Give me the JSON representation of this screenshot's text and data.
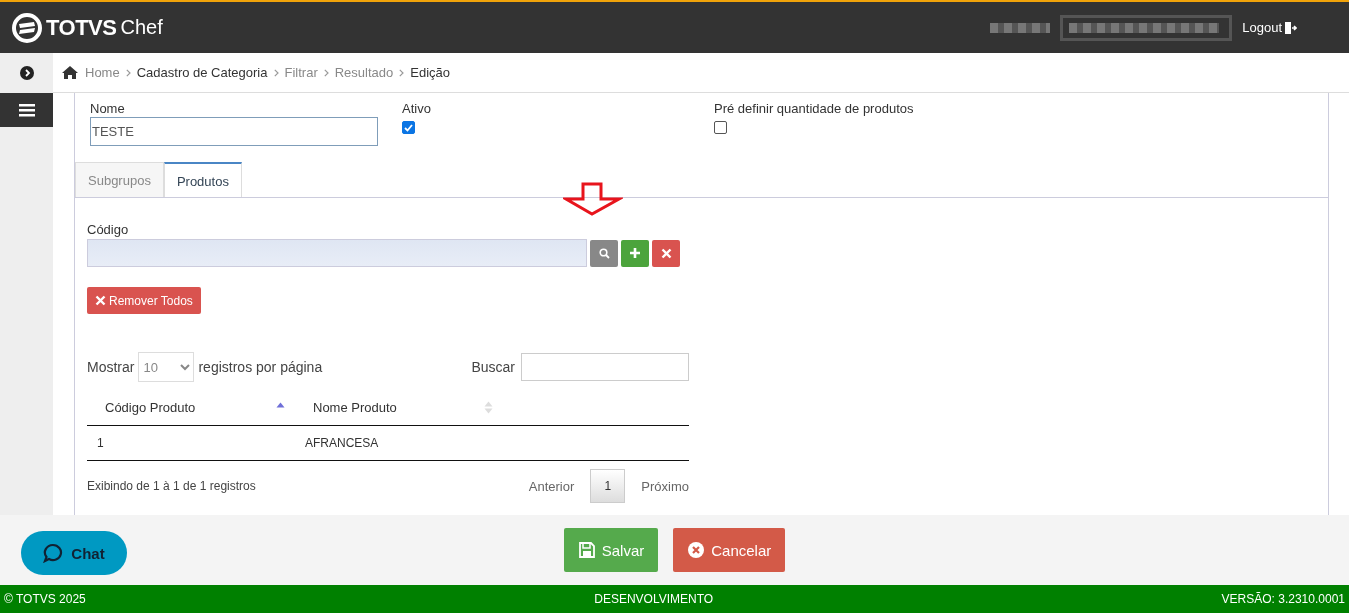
{
  "header": {
    "logo": {
      "brand": "TOTVS",
      "product": "Chef"
    },
    "logout": "Logout"
  },
  "breadcrumb": [
    {
      "label": "Home",
      "kind": "muted"
    },
    {
      "label": "Cadastro de Categoria",
      "kind": "strong"
    },
    {
      "label": "Filtrar",
      "kind": "muted"
    },
    {
      "label": "Resultado",
      "kind": "muted"
    },
    {
      "label": "Edição",
      "kind": "strong"
    }
  ],
  "form": {
    "name": {
      "label": "Nome",
      "value": "TESTE"
    },
    "active": {
      "label": "Ativo",
      "checked": true
    },
    "preset_quantity": {
      "label": "Pré definir quantidade de produtos",
      "checked": false
    }
  },
  "tabs": [
    {
      "label": "Subgrupos",
      "selected": false
    },
    {
      "label": "Produtos",
      "selected": true
    }
  ],
  "code_field": {
    "label": "Código"
  },
  "remove_all": "Remover Todos",
  "table": {
    "show_label": "Mostrar",
    "page_size": "10",
    "per_page_label": "registros por página",
    "search_label": "Buscar",
    "columns": [
      {
        "label": "Código Produto",
        "sorted": true
      },
      {
        "label": "Nome Produto",
        "sorted": false
      }
    ],
    "rows": [
      [
        "1",
        "AFRANCESA"
      ]
    ],
    "info": "Exibindo de 1 à 1 de 1 registros",
    "pagination": {
      "previous": "Anterior",
      "pages": [
        {
          "label": "1",
          "selected": true
        }
      ],
      "next": "Próximo"
    }
  },
  "actions": [
    {
      "label": "Salvar",
      "kind": "save"
    },
    {
      "label": "Cancelar",
      "kind": "cancel"
    }
  ],
  "chat": "Chat",
  "footer": {
    "copyright": "© TOTVS 2025",
    "environment": "DESENVOLVIMENTO",
    "version": "VERSÃO: 3.2310.0001"
  }
}
